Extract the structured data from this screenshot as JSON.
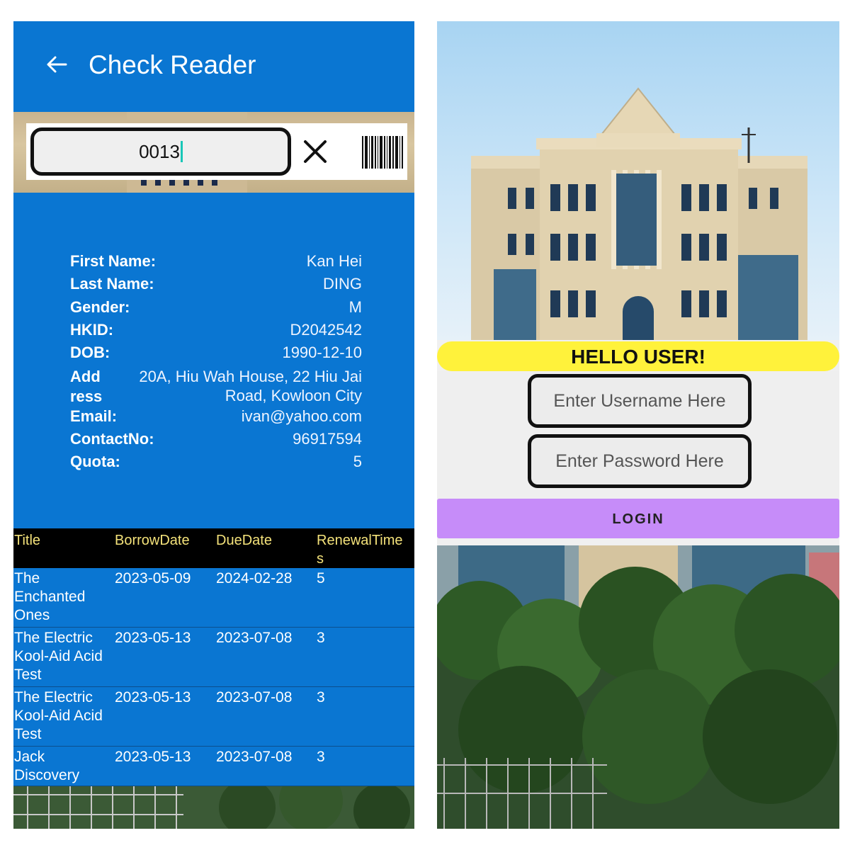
{
  "left_screen": {
    "appbar": {
      "title": "Check Reader",
      "back_icon": "arrow-left-icon"
    },
    "search": {
      "value": "0013",
      "clear_icon": "close-icon",
      "scan_icon": "barcode-icon"
    },
    "reader": {
      "fields": [
        {
          "label": "First Name:",
          "value": "Kan Hei"
        },
        {
          "label": "Last Name:",
          "value": "DING"
        },
        {
          "label": "Gender:",
          "value": "M"
        },
        {
          "label": "HKID:",
          "value": "D2042542"
        },
        {
          "label": "DOB:",
          "value": "1990-12-10"
        },
        {
          "label": "Add\nress",
          "value": "20A, Hiu Wah House, 22 Hiu Jai\nRoad, Kowloon City"
        },
        {
          "label": "Email:",
          "value": "ivan@yahoo.com"
        },
        {
          "label": "ContactNo:",
          "value": "96917594"
        },
        {
          "label": "Quota:",
          "value": "5"
        }
      ]
    },
    "table": {
      "headers": [
        "Title",
        "BorrowDate",
        "DueDate",
        "RenewalTime\ns"
      ],
      "rows": [
        {
          "title": "The\nEnchanted\nOnes",
          "borrow": "2023-05-09",
          "due": "2024-02-28",
          "renewal": "5"
        },
        {
          "title": "The Electric\nKool-Aid Acid\nTest",
          "borrow": "2023-05-13",
          "due": "2023-07-08",
          "renewal": "3"
        },
        {
          "title": "The Electric\nKool-Aid Acid\nTest",
          "borrow": "2023-05-13",
          "due": "2023-07-08",
          "renewal": "3"
        },
        {
          "title": "Jack\nDiscovery",
          "borrow": "2023-05-13",
          "due": "2023-07-08",
          "renewal": "3"
        }
      ]
    },
    "colors": {
      "primary": "#0a76d2",
      "header_bg": "#000000",
      "header_text": "#f4e27a"
    }
  },
  "right_screen": {
    "greeting": "HELLO USER!",
    "username_placeholder": "Enter Username Here",
    "password_placeholder": "Enter Password Here",
    "login_label": "LOGIN",
    "colors": {
      "greeting_bg": "#fff23b",
      "login_bg": "#c68cf9"
    }
  }
}
